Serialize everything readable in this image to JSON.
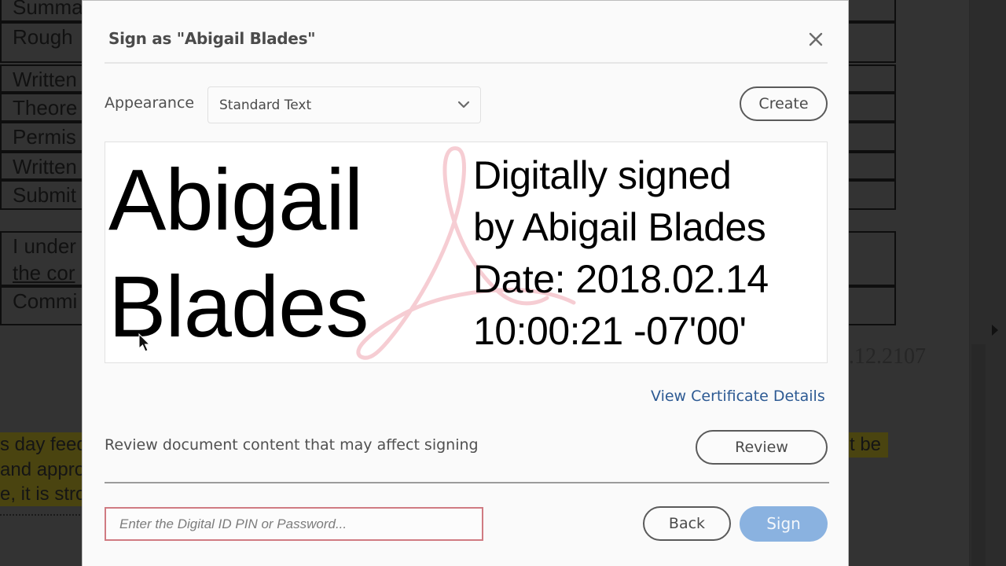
{
  "background_document": {
    "table_rows": [
      "Summa",
      "Rough",
      "Written",
      "Theore",
      "Permis",
      "Written",
      "Submit"
    ],
    "statement_rows": [
      "I under",
      "the cor",
      "Commi"
    ],
    "highlighted_lines": [
      "s day feed",
      "and appro",
      "e, it is stro"
    ],
    "highlighted_tail": "t be",
    "date_fragment": ".12.2107"
  },
  "dialog": {
    "title": "Sign as \"Abigail Blades\"",
    "close_icon": "close-icon",
    "appearance": {
      "label": "Appearance",
      "selected": "Standard Text",
      "dropdown_icon": "chevron-down-icon"
    },
    "create_label": "Create",
    "preview": {
      "name_lines": [
        "Abigail",
        "Blades"
      ],
      "detail_lines": [
        "Digitally signed",
        "by Abigail Blades",
        "Date: 2018.02.14",
        "10:00:21 -07'00'"
      ],
      "watermark_icon": "acrobat-logo-icon",
      "watermark_color": "#f4c9cf"
    },
    "view_certificate_label": "View Certificate Details",
    "review_text": "Review document content that may affect signing",
    "review_label": "Review",
    "pin_input": {
      "value": "",
      "placeholder": "Enter the Digital ID PIN or Password..."
    },
    "back_label": "Back",
    "sign_label": "Sign",
    "colors": {
      "link": "#2d5a93",
      "sign_button": "#8ab2e0",
      "pin_border_error": "#d07b82"
    }
  }
}
